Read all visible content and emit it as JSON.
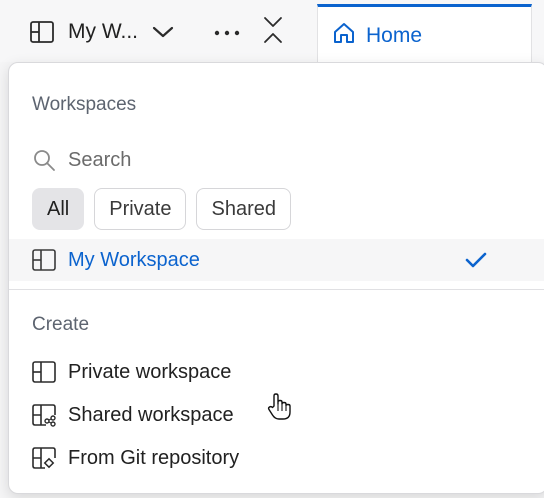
{
  "topbar": {
    "workspace_title": "My W...",
    "workspace_icon": "workspace-panel-icon",
    "more_icon": "more-horizontal-icon",
    "collapse_icon": "collapse-icon"
  },
  "tab": {
    "label": "Home",
    "icon": "home-icon"
  },
  "dropdown": {
    "workspaces_heading": "Workspaces",
    "search_placeholder": "Search",
    "filters": [
      "All",
      "Private",
      "Shared"
    ],
    "active_filter": "All",
    "workspace_items": [
      {
        "label": "My Workspace",
        "selected": true,
        "icon": "workspace-panel-icon"
      }
    ],
    "create_heading": "Create",
    "create_items": [
      {
        "label": "Private workspace",
        "icon": "private-workspace-icon"
      },
      {
        "label": "Shared workspace",
        "icon": "shared-workspace-icon"
      },
      {
        "label": "From Git repository",
        "icon": "git-repository-icon"
      }
    ]
  },
  "colors": {
    "accent": "#0b63ce",
    "muted_text": "#5d6470",
    "selected_row_bg": "#f6f6f7"
  }
}
